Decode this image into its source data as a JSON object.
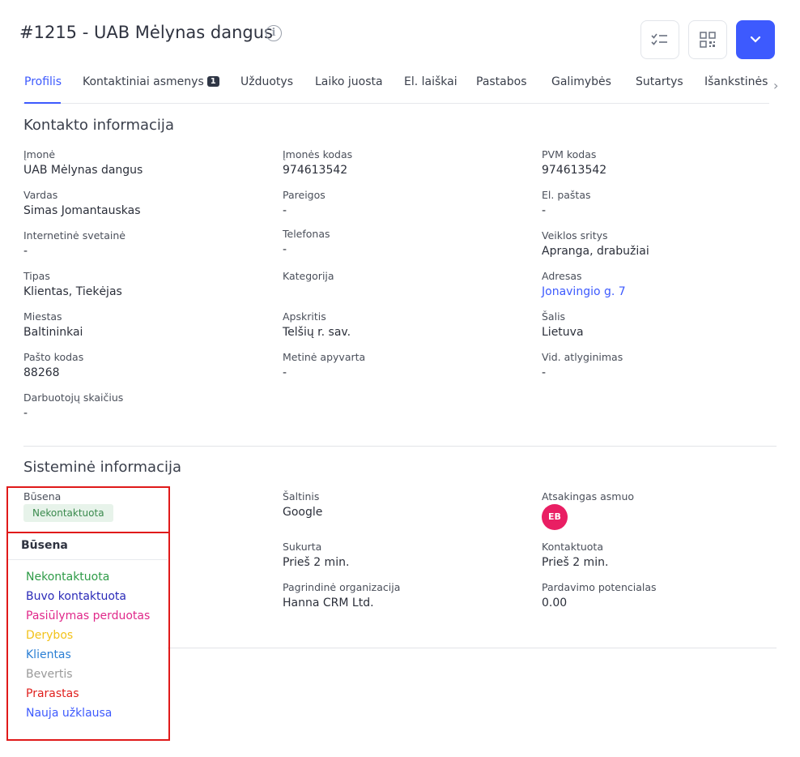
{
  "header": {
    "title": "#1215 - UAB Mėlynas dangus",
    "info_icon": "info-circle-icon",
    "buttons": [
      {
        "name": "task-checklist-button",
        "icon": "checklist-icon"
      },
      {
        "name": "qr-code-button",
        "icon": "qr-code-icon"
      },
      {
        "name": "more-actions-button",
        "icon": "chevron-down-icon"
      }
    ],
    "accent_color": "#3d5afe"
  },
  "tabs": [
    {
      "label": "Profilis",
      "active": true
    },
    {
      "label": "Kontaktiniai asmenys",
      "badge": "1"
    },
    {
      "label": "Užduotys"
    },
    {
      "label": "Laiko juosta"
    },
    {
      "label": "El. laiškai"
    },
    {
      "label": "Pastabos"
    },
    {
      "label": "Galimybės"
    },
    {
      "label": "Sutartys"
    },
    {
      "label": "Išankstinės"
    }
  ],
  "contact": {
    "title": "Kontakto informacija",
    "fields": {
      "imone": {
        "label": "Įmonė",
        "value": "UAB Mėlynas dangus"
      },
      "imones_kodas": {
        "label": "Įmonės kodas",
        "value": "974613542"
      },
      "pvm_kodas": {
        "label": "PVM kodas",
        "value": "974613542"
      },
      "vardas": {
        "label": "Vardas",
        "value": "Simas Jomantauskas"
      },
      "pareigos": {
        "label": "Pareigos",
        "value": "-"
      },
      "el_pastas": {
        "label": "El. paštas",
        "value": "-"
      },
      "svetaine": {
        "label": "Internetinė svetainė",
        "value": "-"
      },
      "telefonas": {
        "label": "Telefonas",
        "value": "-"
      },
      "veiklos_sritys": {
        "label": "Veiklos sritys",
        "value": "Apranga, drabužiai"
      },
      "tipas": {
        "label": "Tipas",
        "value": "Klientas, Tiekėjas"
      },
      "kategorija": {
        "label": "Kategorija",
        "value": ""
      },
      "adresas": {
        "label": "Adresas",
        "value": "Jonavingio g. 7"
      },
      "miestas": {
        "label": "Miestas",
        "value": "Baltininkai"
      },
      "apskritis": {
        "label": "Apskritis",
        "value": "Telšių r. sav."
      },
      "salis": {
        "label": "Šalis",
        "value": "Lietuva"
      },
      "pasto_kodas": {
        "label": "Pašto kodas",
        "value": "88268"
      },
      "apyvarta": {
        "label": "Metinė apyvarta",
        "value": "-"
      },
      "atlyginimas": {
        "label": "Vid. atlyginimas",
        "value": "-"
      },
      "darbuotojai": {
        "label": "Darbuotojų skaičius",
        "value": "-"
      }
    }
  },
  "system": {
    "title": "Sisteminė informacija",
    "busena": {
      "label": "Būsena",
      "value": "Nekontaktuota"
    },
    "saltinis": {
      "label": "Šaltinis",
      "value": "Google"
    },
    "atsakingas": {
      "label": "Atsakingas asmuo",
      "initials": "EB"
    },
    "sukurta": {
      "label": "Sukurta",
      "value": "Prieš 2 min."
    },
    "kontaktuota": {
      "label": "Kontaktuota",
      "value": "Prieš 2 min."
    },
    "organizacija": {
      "label": "Pagrindinė organizacija",
      "value": "Hanna CRM Ltd."
    },
    "potencialas": {
      "label": "Pardavimo potencialas",
      "value": "0.00"
    }
  },
  "status_dropdown": {
    "header": "Būsena",
    "options": [
      {
        "label": "Nekontaktuota",
        "color": "#2e9b47"
      },
      {
        "label": "Buvo kontaktuota",
        "color": "#2a2ab8"
      },
      {
        "label": "Pasiūlymas perduotas",
        "color": "#e0288a"
      },
      {
        "label": "Derybos",
        "color": "#f2c21a"
      },
      {
        "label": "Klientas",
        "color": "#2b7fd4"
      },
      {
        "label": "Bevertis",
        "color": "#9a9a9a"
      },
      {
        "label": "Prarastas",
        "color": "#e0201e"
      },
      {
        "label": "Nauja užklausa",
        "color": "#3d5afe"
      }
    ],
    "highlight_color": "#e01a1a"
  }
}
